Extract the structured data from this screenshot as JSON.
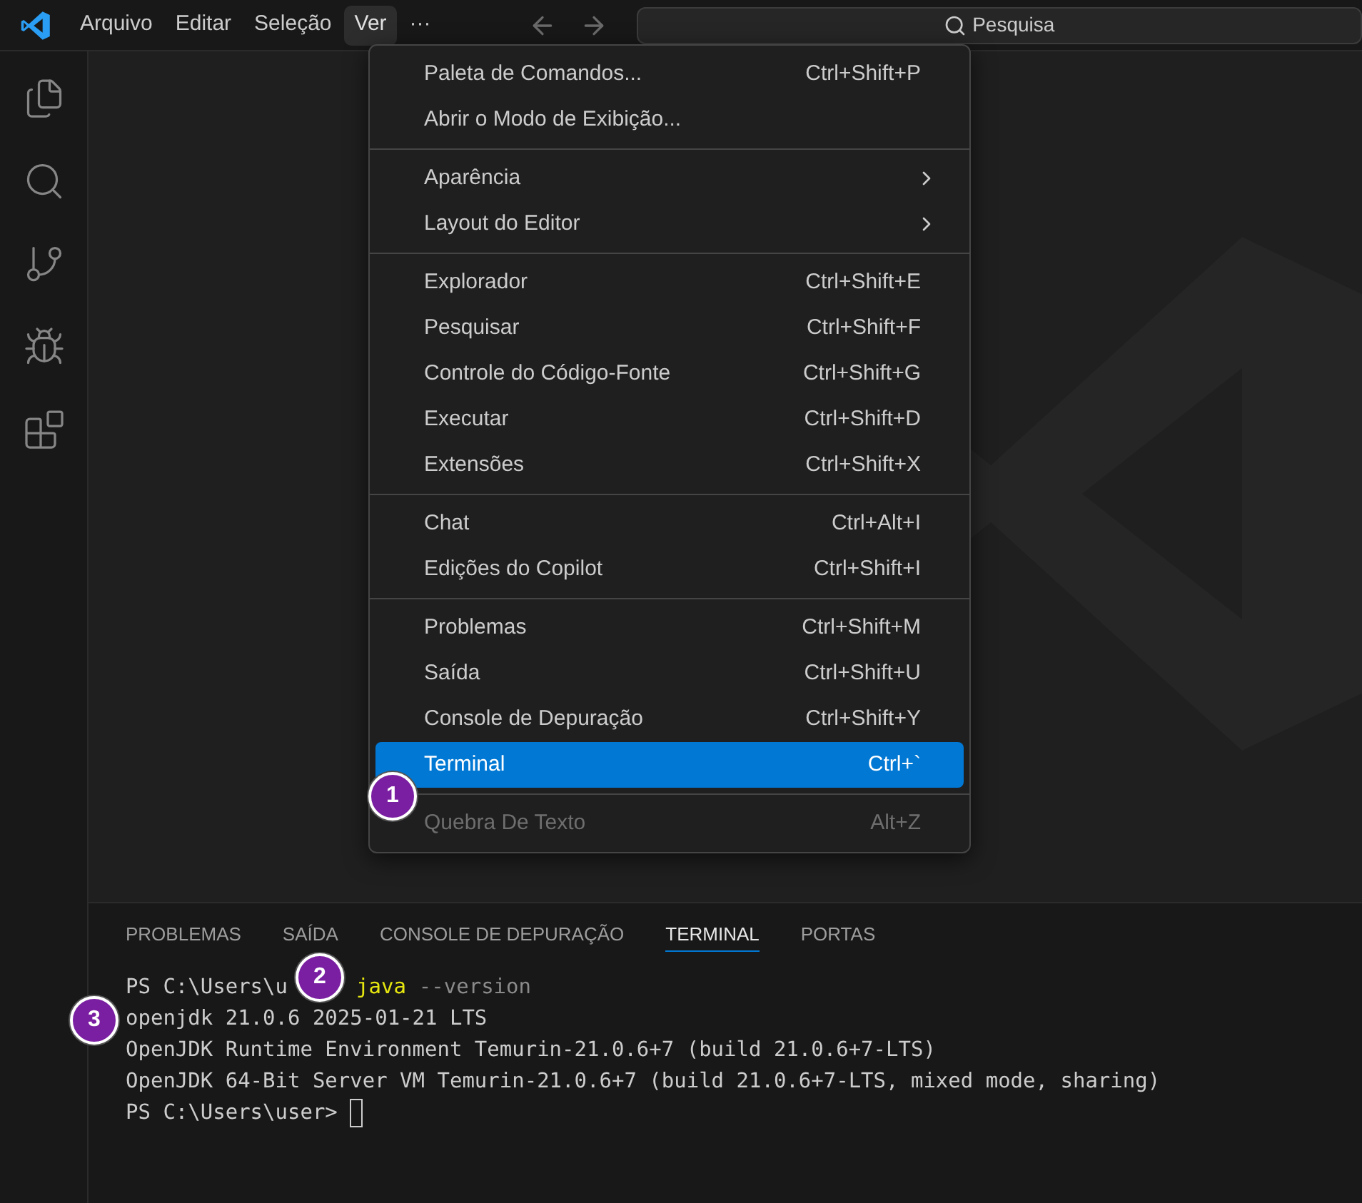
{
  "menubar": {
    "items": [
      {
        "label": "Arquivo",
        "selected": false
      },
      {
        "label": "Editar",
        "selected": false
      },
      {
        "label": "Seleção",
        "selected": false
      },
      {
        "label": "Ver",
        "selected": true
      },
      {
        "label": "···",
        "selected": false
      }
    ]
  },
  "search": {
    "placeholder": "Pesquisa"
  },
  "view_menu": {
    "groups": [
      [
        {
          "kind": "command",
          "label": "Paleta de Comandos...",
          "shortcut": "Ctrl+Shift+P",
          "selected": false,
          "disabled": false
        },
        {
          "kind": "command",
          "label": "Abrir o Modo de Exibição...",
          "selected": false,
          "disabled": false
        }
      ],
      [
        {
          "kind": "submenu",
          "label": "Aparência",
          "selected": false,
          "disabled": false
        },
        {
          "kind": "submenu",
          "label": "Layout do Editor",
          "selected": false,
          "disabled": false
        }
      ],
      [
        {
          "kind": "command",
          "label": "Explorador",
          "shortcut": "Ctrl+Shift+E",
          "selected": false,
          "disabled": false
        },
        {
          "kind": "command",
          "label": "Pesquisar",
          "shortcut": "Ctrl+Shift+F",
          "selected": false,
          "disabled": false
        },
        {
          "kind": "command",
          "label": "Controle do Código-Fonte",
          "shortcut": "Ctrl+Shift+G",
          "selected": false,
          "disabled": false
        },
        {
          "kind": "command",
          "label": "Executar",
          "shortcut": "Ctrl+Shift+D",
          "selected": false,
          "disabled": false
        },
        {
          "kind": "command",
          "label": "Extensões",
          "shortcut": "Ctrl+Shift+X",
          "selected": false,
          "disabled": false
        }
      ],
      [
        {
          "kind": "command",
          "label": "Chat",
          "shortcut": "Ctrl+Alt+I",
          "selected": false,
          "disabled": false
        },
        {
          "kind": "command",
          "label": "Edições do Copilot",
          "shortcut": "Ctrl+Shift+I",
          "selected": false,
          "disabled": false
        }
      ],
      [
        {
          "kind": "command",
          "label": "Problemas",
          "shortcut": "Ctrl+Shift+M",
          "selected": false,
          "disabled": false
        },
        {
          "kind": "command",
          "label": "Saída",
          "shortcut": "Ctrl+Shift+U",
          "selected": false,
          "disabled": false
        },
        {
          "kind": "command",
          "label": "Console de Depuração",
          "shortcut": "Ctrl+Shift+Y",
          "selected": false,
          "disabled": false
        },
        {
          "kind": "command",
          "label": "Terminal",
          "shortcut": "Ctrl+`",
          "selected": true,
          "disabled": false
        }
      ],
      [
        {
          "kind": "command",
          "label": "Quebra De Texto",
          "shortcut": "Alt+Z",
          "selected": false,
          "disabled": true
        }
      ]
    ]
  },
  "panel": {
    "tabs": [
      {
        "label": "PROBLEMAS",
        "selected": false
      },
      {
        "label": "SAÍDA",
        "selected": false
      },
      {
        "label": "CONSOLE DE DEPURAÇÃO",
        "selected": false
      },
      {
        "label": "TERMINAL",
        "selected": true
      },
      {
        "label": "PORTAS",
        "selected": false
      }
    ],
    "terminal": {
      "lines": [
        {
          "prompt": "PS C:\\Users\\u",
          "command": "java",
          "args": "--version"
        },
        {
          "text": "openjdk 21.0.6 2025-01-21 LTS"
        },
        {
          "text": "OpenJDK Runtime Environment Temurin-21.0.6+7 (build 21.0.6+7-LTS)"
        },
        {
          "text": "OpenJDK 64-Bit Server VM Temurin-21.0.6+7 (build 21.0.6+7-LTS, mixed mode, sharing)"
        },
        {
          "prompt": "PS C:\\Users\\user>",
          "cursor": true
        }
      ]
    }
  },
  "callouts": [
    "1",
    "2",
    "3"
  ]
}
